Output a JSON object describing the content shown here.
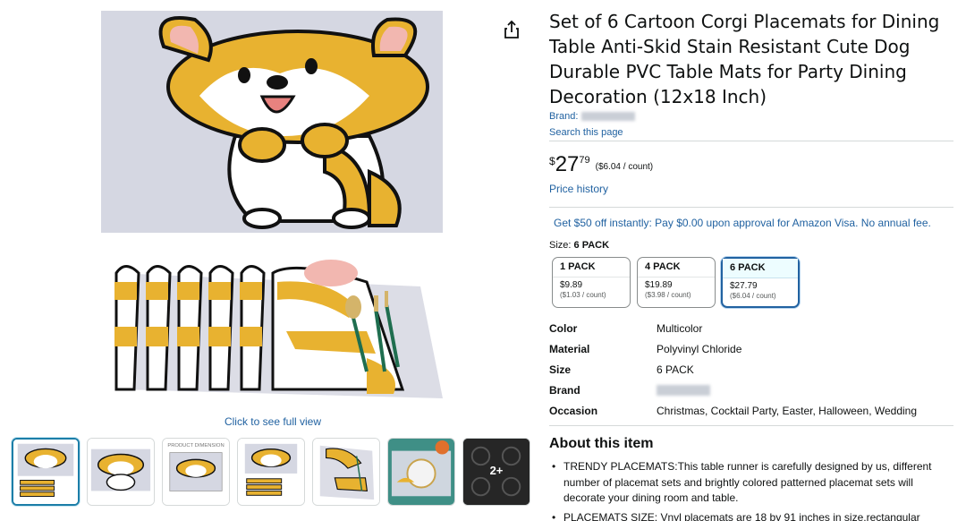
{
  "product": {
    "title": "Set of 6 Cartoon Corgi Placemats for Dining Table Anti-Skid Stain Resistant Cute Dog Durable PVC Table Mats for Party Dining Decoration (12x18 Inch)",
    "brand_label": "Brand:",
    "search_page": "Search this page",
    "price": {
      "symbol": "$",
      "whole": "27",
      "fraction": "79",
      "per_unit": "($6.04 / count)"
    },
    "price_history": "Price history",
    "promo": "Get $50 off instantly: Pay $0.00 upon approval for Amazon Visa. No annual fee."
  },
  "gallery": {
    "click_full_view": "Click to see full view",
    "thumb_more_label": "2+",
    "thumb_dimension_label": "PRODUCT DIMENSION"
  },
  "size": {
    "label": "Size:",
    "selected": "6 PACK",
    "options": [
      {
        "name": "1 PACK",
        "price": "$9.89",
        "unit": "($1.03 / count)"
      },
      {
        "name": "4 PACK",
        "price": "$19.89",
        "unit": "($3.98 / count)"
      },
      {
        "name": "6 PACK",
        "price": "$27.79",
        "unit": "($6.04 / count)"
      }
    ]
  },
  "specs": [
    {
      "key": "Color",
      "value": "Multicolor"
    },
    {
      "key": "Material",
      "value": "Polyvinyl Chloride"
    },
    {
      "key": "Size",
      "value": "6 PACK"
    },
    {
      "key": "Brand",
      "value": ""
    },
    {
      "key": "Occasion",
      "value": "Christmas, Cocktail Party, Easter, Halloween, Wedding"
    }
  ],
  "about": {
    "heading": "About this item",
    "bullets": [
      "TRENDY PLACEMATS:This table runner is carefully designed by us, different number of placemat sets and brightly colored patterned placemat sets will decorate your dining room and table.",
      "PLACEMATS SIZE: Vnyl placemats are 18 by 91 inches in size,rectangular"
    ]
  },
  "colors": {
    "link": "#2162a1",
    "corgi_orange": "#e8b230",
    "selected_border": "#2162a1"
  },
  "icons": [
    "share-icon"
  ]
}
